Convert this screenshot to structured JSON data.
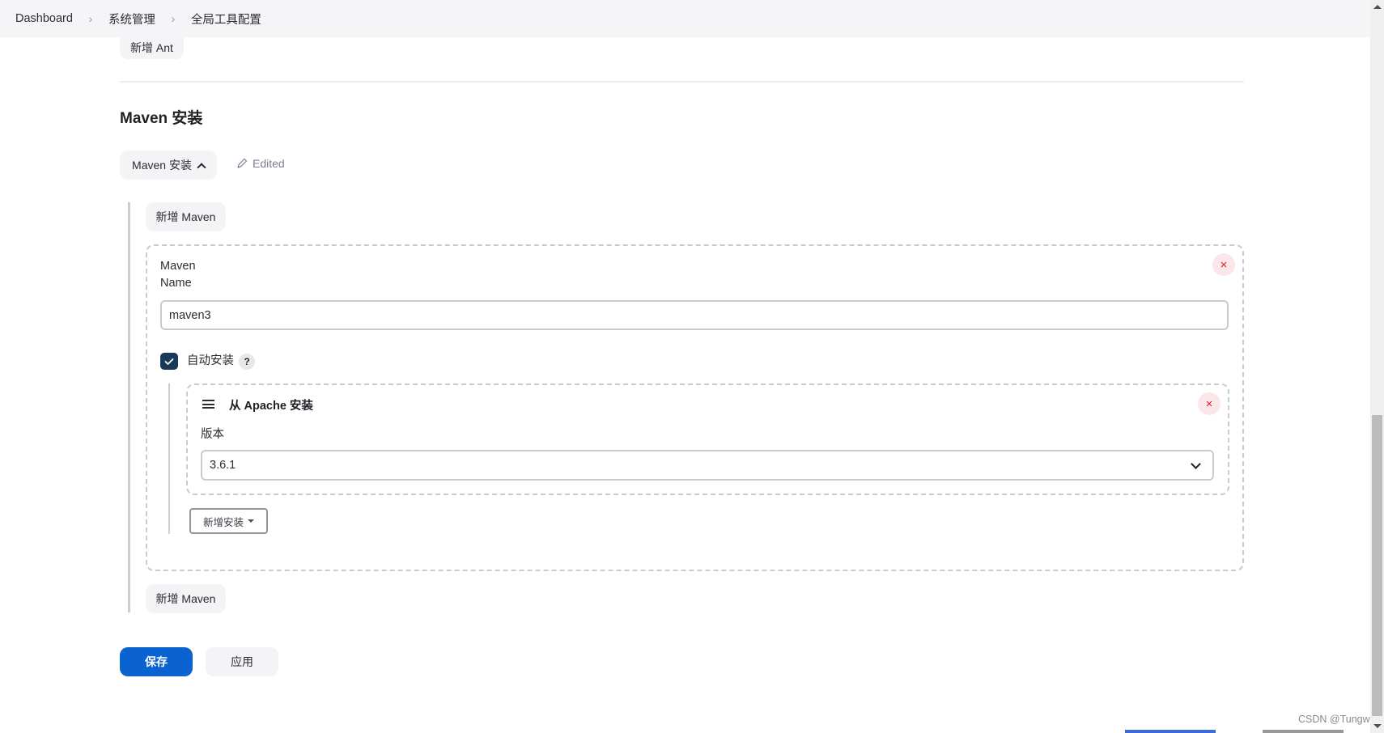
{
  "breadcrumb": [
    {
      "label": "Dashboard"
    },
    {
      "label": "系统管理"
    },
    {
      "label": "全局工具配置"
    }
  ],
  "ant": {
    "add_button": "新增 Ant"
  },
  "maven_section": {
    "title": "Maven 安装",
    "toggle_label": "Maven 安装",
    "edited_label": "Edited",
    "add_button_top": "新增 Maven",
    "add_button_bottom": "新增 Maven",
    "installation": {
      "name_label_line1": "Maven",
      "name_label_line2": "Name",
      "name_value": "maven3",
      "close_symbol": "×",
      "auto_install": {
        "label": "自动安装",
        "checked": true,
        "help_symbol": "?"
      },
      "installer": {
        "title": "从 Apache 安装",
        "version_label": "版本",
        "version_value": "3.6.1",
        "close_symbol": "×"
      },
      "add_installer_button": "新增安装"
    }
  },
  "actions": {
    "save": "保存",
    "apply": "应用"
  },
  "watermark": "CSDN @Tungwli",
  "colors": {
    "primary": "#0a63d0",
    "checkbox": "#183a58",
    "danger": "#e0172f"
  }
}
